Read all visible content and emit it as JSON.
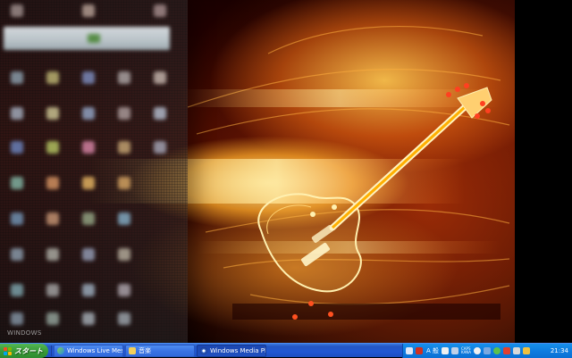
{
  "desktop": {
    "watermark": "WINDOWS",
    "colors": {
      "fire": "#ff9a20",
      "glow": "#ffe89a",
      "dark": "#1a0000"
    }
  },
  "taskbar": {
    "start_label": "スタート",
    "tasks": [
      {
        "label": "Windows Live Messe...",
        "icon": "messenger-icon",
        "active": false
      },
      {
        "label": "音楽",
        "icon": "folder-icon",
        "active": false
      },
      {
        "label": "Windows Media Player",
        "icon": "media-player-icon",
        "active": true
      }
    ],
    "tray": {
      "ime_label": "A 般",
      "caps_label": "CAPS",
      "kana_label": "KANA",
      "clock": "21:34"
    }
  }
}
